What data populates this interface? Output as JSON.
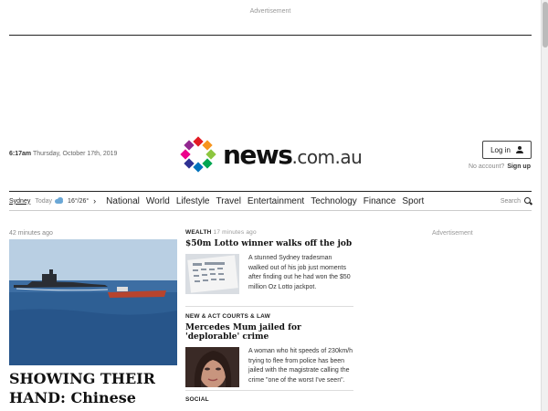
{
  "top_ad": {
    "label": "Advertisement"
  },
  "header": {
    "time": "6:17am",
    "date": "Thursday, October 17th, 2019",
    "logo": {
      "main": "news",
      "tld": ".com.au",
      "dot_colors": [
        "#e31b23",
        "#f7941d",
        "#8dc63f",
        "#00a651",
        "#0072bc",
        "#2e3192",
        "#ec008c",
        "#92278f"
      ]
    },
    "login_label": "Log in",
    "no_account": "No account?",
    "signup": "Sign up"
  },
  "nav": {
    "city": "Sydney",
    "today": "Today",
    "temp": "16°/26°",
    "items": [
      "National",
      "World",
      "Lifestyle",
      "Travel",
      "Entertainment",
      "Technology",
      "Finance",
      "Sport"
    ],
    "search": "Search"
  },
  "lead": {
    "time": "42 minutes ago",
    "headline": "SHOWING THEIR HAND: Chinese nuclear sub in"
  },
  "stories": [
    {
      "section": "WEALTH",
      "time": "17 minutes ago",
      "headline": "$50m Lotto winner walks off the job",
      "blurb": "A stunned Sydney tradesman walked out of his job just moments after finding out he had won the $50 million Oz Lotto jackpot."
    },
    {
      "section": "NEW & ACT COURTS & LAW",
      "time": "",
      "headline": "Mercedes Mum jailed for 'deplorable' crime",
      "blurb": "A woman who hit speeds of 230km/h trying to flee from police has been jailed with the magistrate calling the crime \"one of the worst I've seen\"."
    },
    {
      "section": "SOCIAL",
      "time": "",
      "headline": "",
      "blurb": ""
    }
  ],
  "side_ad": {
    "label": "Advertisement"
  }
}
